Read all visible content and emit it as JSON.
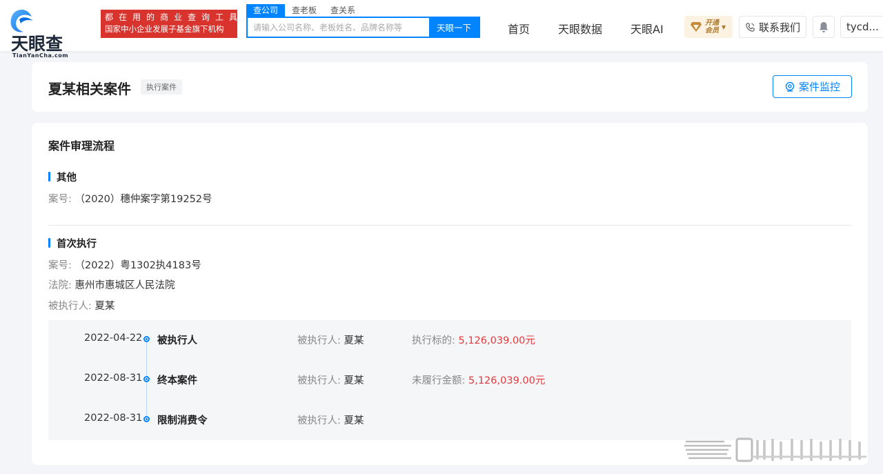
{
  "header": {
    "logo_text": "天眼查",
    "logo_sub": "TianYanCha.com",
    "slogan_line1": "都在用的商业查询工具",
    "slogan_line2": "国家中小企业发展子基金旗下机构",
    "search_tabs": [
      "查公司",
      "查老板",
      "查关系"
    ],
    "search_placeholder": "请输入公司名称、老板姓名、品牌名称等",
    "search_button": "天眼一下",
    "nav": [
      "首页",
      "天眼数据",
      "天眼AI"
    ],
    "vip_label_1": "开通",
    "vip_label_2": "会员",
    "contact_label": "联系我们",
    "user_label": "tycd..."
  },
  "title_card": {
    "title": "夏某相关案件",
    "tag": "执行案件",
    "monitor_label": "案件监控"
  },
  "main": {
    "heading": "案件审理流程",
    "sections": [
      {
        "title": "其他",
        "case_no_label": "案号:",
        "case_no": "（2020）穗仲案字第19252号"
      },
      {
        "title": "首次执行",
        "case_no_label": "案号:",
        "case_no": "（2022）粤1302执4183号",
        "court_label": "法院:",
        "court": "惠州市惠城区人民法院",
        "respondent_label": "被执行人:",
        "respondent": "夏某"
      }
    ],
    "timeline": [
      {
        "date": "2022-04-22",
        "event": "被执行人",
        "party_label": "被执行人:",
        "party": "夏某",
        "amount_label": "执行标的:",
        "amount": "5,126,039.00元"
      },
      {
        "date": "2022-08-31",
        "event": "终本案件",
        "party_label": "被执行人:",
        "party": "夏某",
        "amount_label": "未履行金额:",
        "amount": "5,126,039.00元"
      },
      {
        "date": "2022-08-31",
        "event": "限制消费令",
        "party_label": "被执行人:",
        "party": "夏某",
        "amount_label": "",
        "amount": ""
      }
    ]
  },
  "colors": {
    "accent": "#0084ff",
    "slogan_bg": "#d9332e",
    "amount": "#e4393c",
    "vip_gold": "#b07a2e"
  }
}
